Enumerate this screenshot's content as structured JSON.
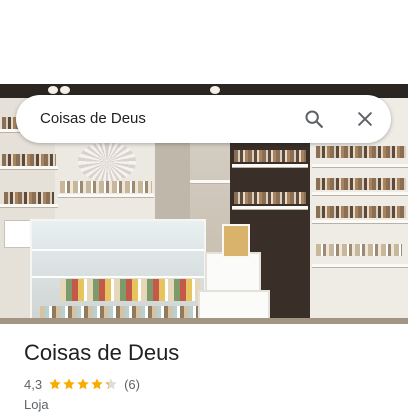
{
  "search": {
    "query": "Coisas de Deus"
  },
  "place": {
    "name": "Coisas de Deus",
    "rating": "4,3",
    "rating_stars": 4.3,
    "rating_max": 5,
    "reviews_count": "(6)",
    "category": "Loja"
  },
  "icons": {
    "search": "search-icon",
    "close": "close-icon",
    "star": "star-icon"
  },
  "colors": {
    "star": "#f9ab00",
    "star_empty": "#dadce0",
    "text_primary": "#202124",
    "text_secondary": "#5f6368",
    "icon": "#5f6368"
  }
}
